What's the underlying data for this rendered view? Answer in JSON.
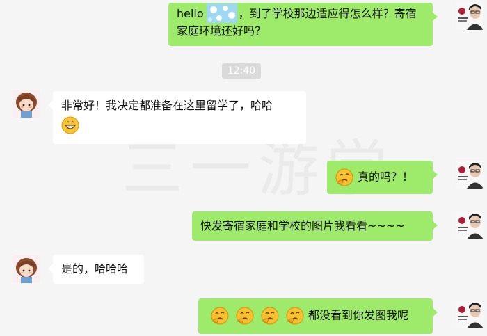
{
  "watermark": "三一游学",
  "time_divider": "12:40",
  "avatars": {
    "me_icon": "portrait-with-red-logo-avatar",
    "friend_icon": "cartoon-girl-avatar"
  },
  "messages": [
    {
      "id": 1,
      "side": "me",
      "text_before": "hello",
      "text_after": "，到了学校那边适应得怎么样？寄宿家庭环境还好吗？"
    },
    {
      "id": 2,
      "side": "friend",
      "text": "非常好！我决定都准备在这里留学了，哈哈",
      "emoji": "grinning-face"
    },
    {
      "id": 3,
      "side": "me",
      "emoji": "thinking-face",
      "text": "真的吗？！"
    },
    {
      "id": 4,
      "side": "me",
      "text": "快发寄宿家庭和学校的图片我看看~~~~"
    },
    {
      "id": 5,
      "side": "friend",
      "text": "是的，哈哈哈"
    },
    {
      "id": 6,
      "side": "me",
      "emoji": "thinking-face",
      "emoji_count": 4,
      "text": "都没看到你发图我呢"
    }
  ],
  "colors": {
    "background": "#f5f5f5",
    "my_bubble": "#9eea6a",
    "friend_bubble": "#ffffff",
    "time_badge": "#dadada"
  }
}
